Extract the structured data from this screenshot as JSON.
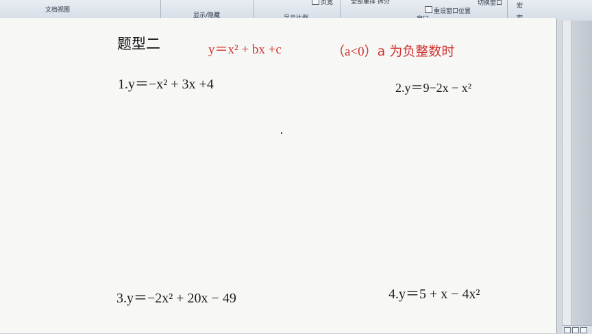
{
  "ribbon": {
    "doc_view": "文档视图",
    "show_hide": "显示/隐藏",
    "zoom": "显示比例",
    "window": "窗口",
    "macro": "宏",
    "macro_top": "宏",
    "page_partial": "页宽",
    "reset_window": "重设窗口位置",
    "switch_window": "切换窗口",
    "top_partial": "全部重排  拆分"
  },
  "document": {
    "title": "题型二",
    "template_eq": "y＝x² + bx  +c",
    "condition_prefix": "（",
    "condition_a": "a<0",
    "condition_suffix": "）a 为负整数时",
    "q1": "1.y＝−x² + 3x  +4",
    "q2": "2.y＝9−2x − x²",
    "q3": "3.y＝−2x² + 20x − 49",
    "q4": "4.y＝5 + x − 4x²"
  }
}
